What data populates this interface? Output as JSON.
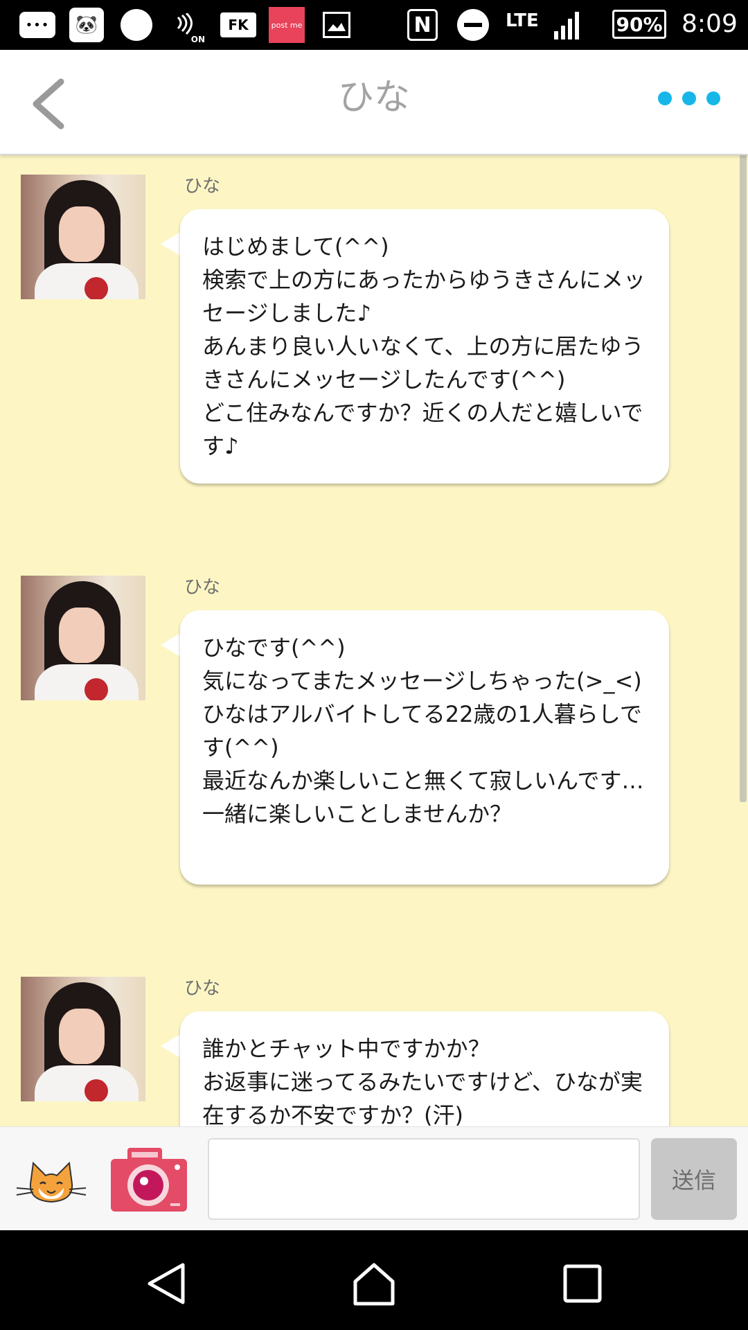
{
  "status_bar": {
    "battery": "90%",
    "time": "8:09",
    "network": "LTE",
    "nfc_on_label": "ON",
    "fk_label": "FK",
    "postme_label": "post me",
    "icons": [
      "chat-bubble-icon",
      "panda-icon",
      "circle-icon",
      "nfc-on-icon",
      "fk-icon",
      "postme-icon",
      "image-icon",
      "nfc-icon",
      "dnd-icon",
      "lte-icon",
      "signal-icon",
      "battery-icon"
    ]
  },
  "header": {
    "title": "ひな",
    "accent": "#16b7e8"
  },
  "messages": [
    {
      "sender": "ひな",
      "text": "はじめまして(^^)\n検索で上の方にあったからゆうきさんにメッセージしました♪\nあんまり良い人いなくて、上の方に居たゆうきさんにメッセージしたんです(^^)\nどこ住みなんですか？近くの人だと嬉しいです♪"
    },
    {
      "sender": "ひな",
      "text": "ひなです(^^)\n気になってまたメッセージしちゃった(>_<)\nひなはアルバイトしてる22歳の1人暮らしです(^^)\n最近なんか楽しいこと無くて寂しいんです…\n一緒に楽しいことしませんか？"
    },
    {
      "sender": "ひな",
      "text": "誰かとチャット中ですかか？\nお返事に迷ってるみたいですけど、ひなが実在するか不安ですか？(汗)"
    }
  ],
  "input_bar": {
    "placeholder": "",
    "send_label": "送信"
  },
  "colors": {
    "chat_background": "#fdf6c4",
    "bubble": "#ffffff",
    "camera": "#e44b66"
  }
}
